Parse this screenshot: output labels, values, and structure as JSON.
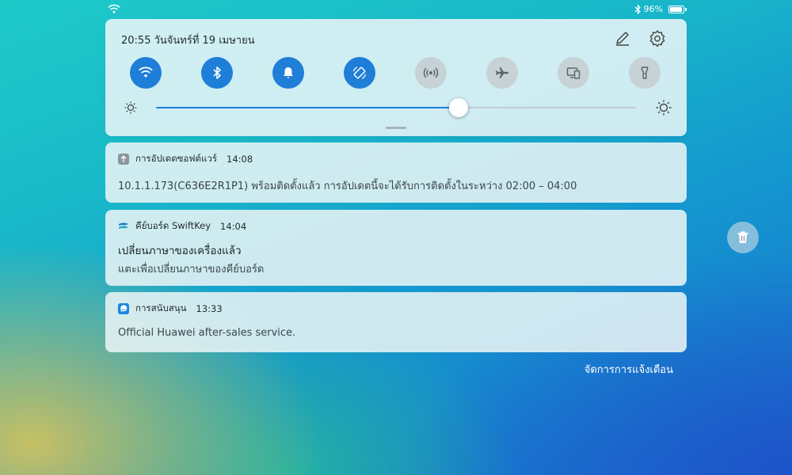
{
  "status_bar": {
    "battery_text": "96%",
    "battery_level": 0.96,
    "icons": [
      "wifi-icon",
      "bluetooth-icon",
      "battery-icon"
    ]
  },
  "quick_panel": {
    "datetime": "20:55 วันจันทร์ที่ 19 เมษายน",
    "icons": [
      "edit-icon",
      "settings-icon"
    ],
    "toggles": [
      {
        "name": "wifi-icon",
        "state": "on"
      },
      {
        "name": "bluetooth-icon",
        "state": "on"
      },
      {
        "name": "bell-icon",
        "state": "on"
      },
      {
        "name": "auto-rotate-icon",
        "state": "on"
      },
      {
        "name": "hotspot-icon",
        "state": "off"
      },
      {
        "name": "airplane-icon",
        "state": "off"
      },
      {
        "name": "multi-screen-icon",
        "state": "off"
      },
      {
        "name": "flashlight-icon",
        "state": "off"
      }
    ],
    "brightness_level": 0.63
  },
  "notifications": [
    {
      "app": "การอัปเดตซอฟต์แวร์",
      "time": "14:08",
      "icon": "update-arrow-icon",
      "title": "",
      "body": "10.1.1.173(C636E2R1P1) พร้อมติดตั้งแล้ว การอัปเดตนี้จะได้รับการติดตั้งในระหว่าง 02:00 – 04:00"
    },
    {
      "app": "คีย์บอร์ด SwiftKey",
      "time": "14:04",
      "icon": "swiftkey-icon",
      "title": "เปลี่ยนภาษาของเครื่องแล้ว",
      "body": "แตะเพื่อเปลี่ยนภาษาของคีย์บอร์ด"
    },
    {
      "app": "การสนับสนุน",
      "time": "13:33",
      "icon": "support-icon",
      "title": "",
      "body": "Official Huawei after-sales service."
    }
  ],
  "trash_icon": "trash-icon",
  "manage_label": "จัดการการแจ้งเตือน",
  "colors": {
    "accent": "#1f7ed8",
    "toggle_off": "#c6d2d6"
  }
}
